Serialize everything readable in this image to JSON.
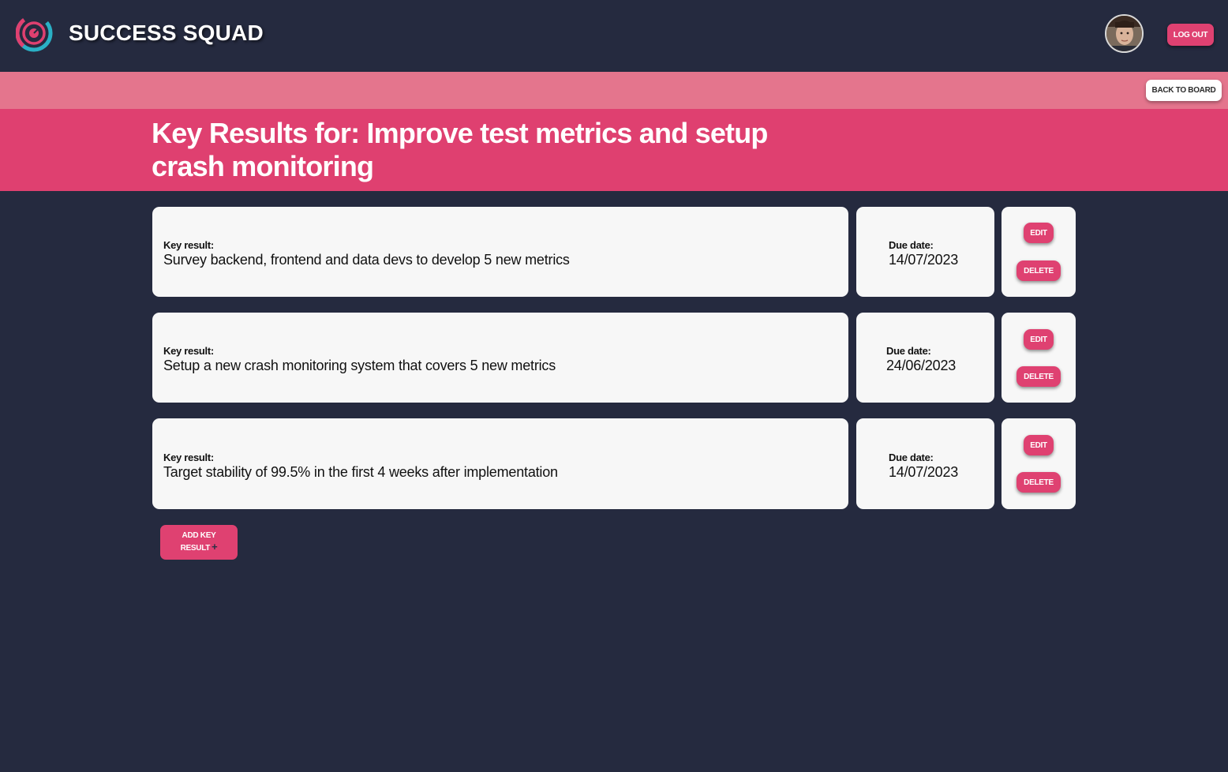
{
  "header": {
    "brand": "SUCCESS SQUAD",
    "logout_label": "LOG OUT",
    "avatar_icon": "user-avatar"
  },
  "subbar": {
    "back_label": "BACK TO BOARD"
  },
  "page": {
    "title_line1": "Key Results for: Improve test metrics and setup",
    "title_line2": "crash monitoring"
  },
  "key_results": [
    {
      "label": "Key result:",
      "text": "Survey backend, frontend and data devs to develop 5 new metrics",
      "due_label": "Due date:",
      "due_date": "14/07/2023",
      "edit_label": "EDIT",
      "delete_label": "DELETE"
    },
    {
      "label": "Key result:",
      "text": "Setup a new crash monitoring system that covers 5 new metrics",
      "due_label": "Due date:",
      "due_date": "24/06/2023",
      "edit_label": "EDIT",
      "delete_label": "DELETE"
    },
    {
      "label": "Key result:",
      "text": "Target stability of 99.5% in the first 4 weeks after implementation",
      "due_label": "Due date:",
      "due_date": "14/07/2023",
      "edit_label": "EDIT",
      "delete_label": "DELETE"
    }
  ],
  "add_button": {
    "line1": "ADD KEY",
    "line2": "RESULT",
    "icon": "plus-icon"
  },
  "colors": {
    "background": "#252a3f",
    "accent": "#df4070",
    "subbar": "#e4758d",
    "card": "#f7f7f7"
  }
}
